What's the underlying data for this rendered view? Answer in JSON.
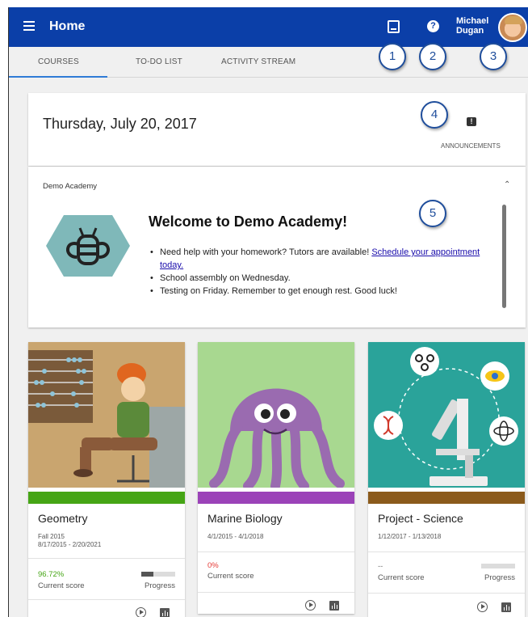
{
  "header": {
    "title": "Home",
    "user_name": "Michael Dugan",
    "icons": [
      "menu-icon",
      "gallery-icon",
      "help-icon",
      "avatar"
    ],
    "brand_color": "#0b3fa8"
  },
  "tabs": [
    {
      "label": "COURSES",
      "active": true
    },
    {
      "label": "TO-DO LIST",
      "active": false
    },
    {
      "label": "ACTIVITY STREAM",
      "active": false
    }
  ],
  "callouts": [
    "1",
    "2",
    "3",
    "4",
    "5"
  ],
  "date_card": {
    "date": "Thursday, July 20, 2017",
    "announcements_label": "ANNOUNCEMENTS",
    "announcements_icon": "!"
  },
  "academy_card": {
    "name": "Demo Academy",
    "welcome": "Welcome to Demo Academy!",
    "bullet1_text": "Need help with your homework? Tutors are available! ",
    "bullet1_link": "Schedule your appointment today.",
    "bullet2": "School assembly on Wednesday.",
    "bullet3": "Testing on Friday. Remember to get enough rest. Good luck!"
  },
  "courses": [
    {
      "title": "Geometry",
      "term": "Fall 2015",
      "dates": "8/17/2015 - 2/20/2021",
      "score": "96.72%",
      "score_label": "Current score",
      "progress_label": "Progress",
      "progress": 0.35,
      "stripe_color": "#45a515",
      "score_color": "#45a515"
    },
    {
      "title": "Marine Biology",
      "term": "",
      "dates": "4/1/2015 - 4/1/2018",
      "score": "0%",
      "score_label": "Current score",
      "progress_label": "",
      "progress": null,
      "stripe_color": "#9b42b8",
      "score_color": "#e53935"
    },
    {
      "title": "Project - Science",
      "term": "",
      "dates": "1/12/2017 - 1/13/2018",
      "score": "--",
      "score_label": "Current score",
      "progress_label": "Progress",
      "progress": 0,
      "stripe_color": "#8b5a1b",
      "score_color": "#777777"
    }
  ]
}
